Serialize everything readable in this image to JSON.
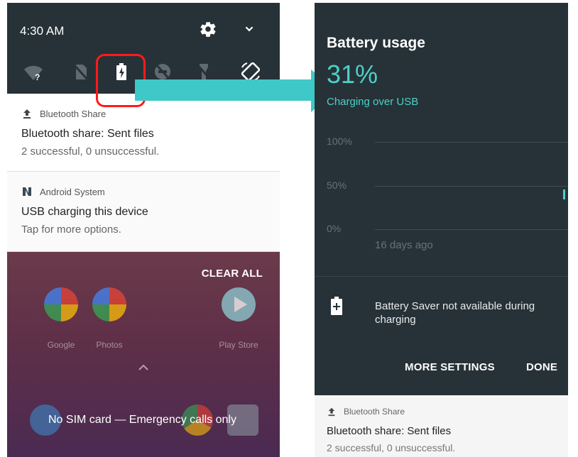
{
  "left_screen": {
    "status": {
      "time": "4:30 AM"
    },
    "quick_settings_tiles": [
      "wifi-unknown-icon",
      "no-sim-icon",
      "battery-charging-icon",
      "do-not-disturb-off-icon",
      "flashlight-off-icon",
      "auto-rotate-icon"
    ],
    "notifications": [
      {
        "app": "Bluetooth Share",
        "title": "Bluetooth share: Sent files",
        "text": "2 successful, 0 unsuccessful."
      },
      {
        "app": "Android System",
        "title": "USB charging this device",
        "text": "Tap for more options."
      }
    ],
    "clear_all_label": "CLEAR ALL",
    "apps": [
      {
        "label": "Google"
      },
      {
        "label": "Photos"
      },
      {
        "label": "Play Store"
      }
    ],
    "sim_status": "No SIM card — Emergency calls only"
  },
  "right_screen": {
    "title": "Battery usage",
    "percent": "31%",
    "charging_status": "Charging over USB",
    "graph": {
      "labels": [
        "100%",
        "50%",
        "0%"
      ],
      "footer": "16 days ago"
    },
    "saver_message": "Battery Saver not available during charging",
    "buttons": {
      "more_settings": "MORE SETTINGS",
      "done": "DONE"
    },
    "notification": {
      "app": "Bluetooth Share",
      "title": "Bluetooth share: Sent files",
      "text": "2 successful, 0 unsuccessful."
    }
  },
  "colors": {
    "panel_dark": "#263238",
    "accent_teal": "#4dd0c7",
    "highlight_red": "#ff1a1a",
    "arrow_cyan": "#3ec8c8"
  }
}
